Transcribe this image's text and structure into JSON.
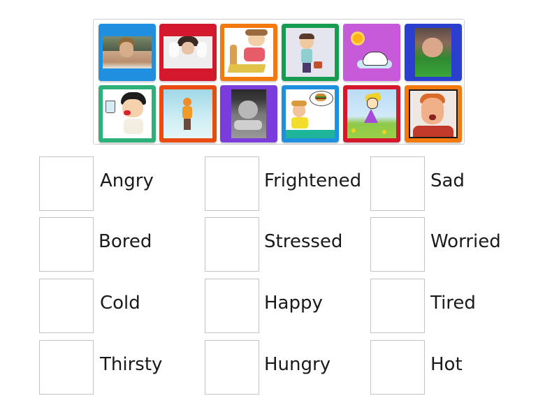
{
  "tiles": [
    {
      "name": "tile-photo-young-man",
      "color": "#1f8fe0",
      "depicts": "young man photo"
    },
    {
      "name": "tile-photo-woman-hands-in-hair",
      "color": "#d4192f",
      "depicts": "woman holding head photo"
    },
    {
      "name": "tile-cartoon-boy-bored-reading",
      "color": "#f47a0f",
      "depicts": "cartoon boy resting head on book"
    },
    {
      "name": "tile-cartoon-man-with-briefcase",
      "color": "#169c50",
      "depicts": "cartoon tired man with briefcase"
    },
    {
      "name": "tile-cartoon-snoopy-sun",
      "color": "#c44ed6",
      "depicts": "cartoon dog melting under sun"
    },
    {
      "name": "tile-photo-grumpy-baby",
      "color": "#2b3fcf",
      "depicts": "grumpy baby photo"
    },
    {
      "name": "tile-cartoon-thirsty-boy",
      "color": "#2fb07a",
      "depicts": "cartoon boy with glass of water"
    },
    {
      "name": "tile-cartoon-cold-girl",
      "color": "#ea4b12",
      "depicts": "cartoon girl shivering in snow"
    },
    {
      "name": "tile-photo-sad-baby",
      "color": "#7a3ddb",
      "depicts": "black and white sad baby photo"
    },
    {
      "name": "tile-cartoon-hungry-boy",
      "color": "#1f8fe0",
      "depicts": "cartoon boy thinking of burger"
    },
    {
      "name": "tile-drawing-happy-girl",
      "color": "#d4192f",
      "depicts": "drawing of happy girl dancing"
    },
    {
      "name": "tile-photo-frightened-boy",
      "color": "#f47a0f",
      "depicts": "boy screaming with hands on face"
    }
  ],
  "targets": [
    {
      "label": "Angry"
    },
    {
      "label": "Frightened"
    },
    {
      "label": "Sad"
    },
    {
      "label": "Bored"
    },
    {
      "label": "Stressed"
    },
    {
      "label": "Worried"
    },
    {
      "label": "Cold"
    },
    {
      "label": "Happy"
    },
    {
      "label": "Tired"
    },
    {
      "label": "Thirsty"
    },
    {
      "label": "Hungry"
    },
    {
      "label": "Hot"
    }
  ]
}
